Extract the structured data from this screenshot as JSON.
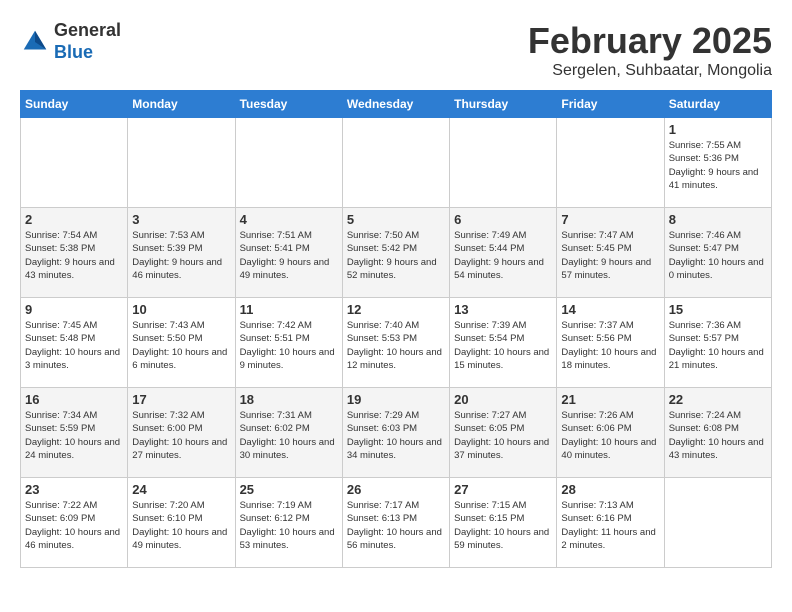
{
  "header": {
    "logo_general": "General",
    "logo_blue": "Blue",
    "month_title": "February 2025",
    "subtitle": "Sergelen, Suhbaatar, Mongolia"
  },
  "weekdays": [
    "Sunday",
    "Monday",
    "Tuesday",
    "Wednesday",
    "Thursday",
    "Friday",
    "Saturday"
  ],
  "weeks": [
    [
      {
        "day": "",
        "info": ""
      },
      {
        "day": "",
        "info": ""
      },
      {
        "day": "",
        "info": ""
      },
      {
        "day": "",
        "info": ""
      },
      {
        "day": "",
        "info": ""
      },
      {
        "day": "",
        "info": ""
      },
      {
        "day": "1",
        "info": "Sunrise: 7:55 AM\nSunset: 5:36 PM\nDaylight: 9 hours and 41 minutes."
      }
    ],
    [
      {
        "day": "2",
        "info": "Sunrise: 7:54 AM\nSunset: 5:38 PM\nDaylight: 9 hours and 43 minutes."
      },
      {
        "day": "3",
        "info": "Sunrise: 7:53 AM\nSunset: 5:39 PM\nDaylight: 9 hours and 46 minutes."
      },
      {
        "day": "4",
        "info": "Sunrise: 7:51 AM\nSunset: 5:41 PM\nDaylight: 9 hours and 49 minutes."
      },
      {
        "day": "5",
        "info": "Sunrise: 7:50 AM\nSunset: 5:42 PM\nDaylight: 9 hours and 52 minutes."
      },
      {
        "day": "6",
        "info": "Sunrise: 7:49 AM\nSunset: 5:44 PM\nDaylight: 9 hours and 54 minutes."
      },
      {
        "day": "7",
        "info": "Sunrise: 7:47 AM\nSunset: 5:45 PM\nDaylight: 9 hours and 57 minutes."
      },
      {
        "day": "8",
        "info": "Sunrise: 7:46 AM\nSunset: 5:47 PM\nDaylight: 10 hours and 0 minutes."
      }
    ],
    [
      {
        "day": "9",
        "info": "Sunrise: 7:45 AM\nSunset: 5:48 PM\nDaylight: 10 hours and 3 minutes."
      },
      {
        "day": "10",
        "info": "Sunrise: 7:43 AM\nSunset: 5:50 PM\nDaylight: 10 hours and 6 minutes."
      },
      {
        "day": "11",
        "info": "Sunrise: 7:42 AM\nSunset: 5:51 PM\nDaylight: 10 hours and 9 minutes."
      },
      {
        "day": "12",
        "info": "Sunrise: 7:40 AM\nSunset: 5:53 PM\nDaylight: 10 hours and 12 minutes."
      },
      {
        "day": "13",
        "info": "Sunrise: 7:39 AM\nSunset: 5:54 PM\nDaylight: 10 hours and 15 minutes."
      },
      {
        "day": "14",
        "info": "Sunrise: 7:37 AM\nSunset: 5:56 PM\nDaylight: 10 hours and 18 minutes."
      },
      {
        "day": "15",
        "info": "Sunrise: 7:36 AM\nSunset: 5:57 PM\nDaylight: 10 hours and 21 minutes."
      }
    ],
    [
      {
        "day": "16",
        "info": "Sunrise: 7:34 AM\nSunset: 5:59 PM\nDaylight: 10 hours and 24 minutes."
      },
      {
        "day": "17",
        "info": "Sunrise: 7:32 AM\nSunset: 6:00 PM\nDaylight: 10 hours and 27 minutes."
      },
      {
        "day": "18",
        "info": "Sunrise: 7:31 AM\nSunset: 6:02 PM\nDaylight: 10 hours and 30 minutes."
      },
      {
        "day": "19",
        "info": "Sunrise: 7:29 AM\nSunset: 6:03 PM\nDaylight: 10 hours and 34 minutes."
      },
      {
        "day": "20",
        "info": "Sunrise: 7:27 AM\nSunset: 6:05 PM\nDaylight: 10 hours and 37 minutes."
      },
      {
        "day": "21",
        "info": "Sunrise: 7:26 AM\nSunset: 6:06 PM\nDaylight: 10 hours and 40 minutes."
      },
      {
        "day": "22",
        "info": "Sunrise: 7:24 AM\nSunset: 6:08 PM\nDaylight: 10 hours and 43 minutes."
      }
    ],
    [
      {
        "day": "23",
        "info": "Sunrise: 7:22 AM\nSunset: 6:09 PM\nDaylight: 10 hours and 46 minutes."
      },
      {
        "day": "24",
        "info": "Sunrise: 7:20 AM\nSunset: 6:10 PM\nDaylight: 10 hours and 49 minutes."
      },
      {
        "day": "25",
        "info": "Sunrise: 7:19 AM\nSunset: 6:12 PM\nDaylight: 10 hours and 53 minutes."
      },
      {
        "day": "26",
        "info": "Sunrise: 7:17 AM\nSunset: 6:13 PM\nDaylight: 10 hours and 56 minutes."
      },
      {
        "day": "27",
        "info": "Sunrise: 7:15 AM\nSunset: 6:15 PM\nDaylight: 10 hours and 59 minutes."
      },
      {
        "day": "28",
        "info": "Sunrise: 7:13 AM\nSunset: 6:16 PM\nDaylight: 11 hours and 2 minutes."
      },
      {
        "day": "",
        "info": ""
      }
    ]
  ]
}
